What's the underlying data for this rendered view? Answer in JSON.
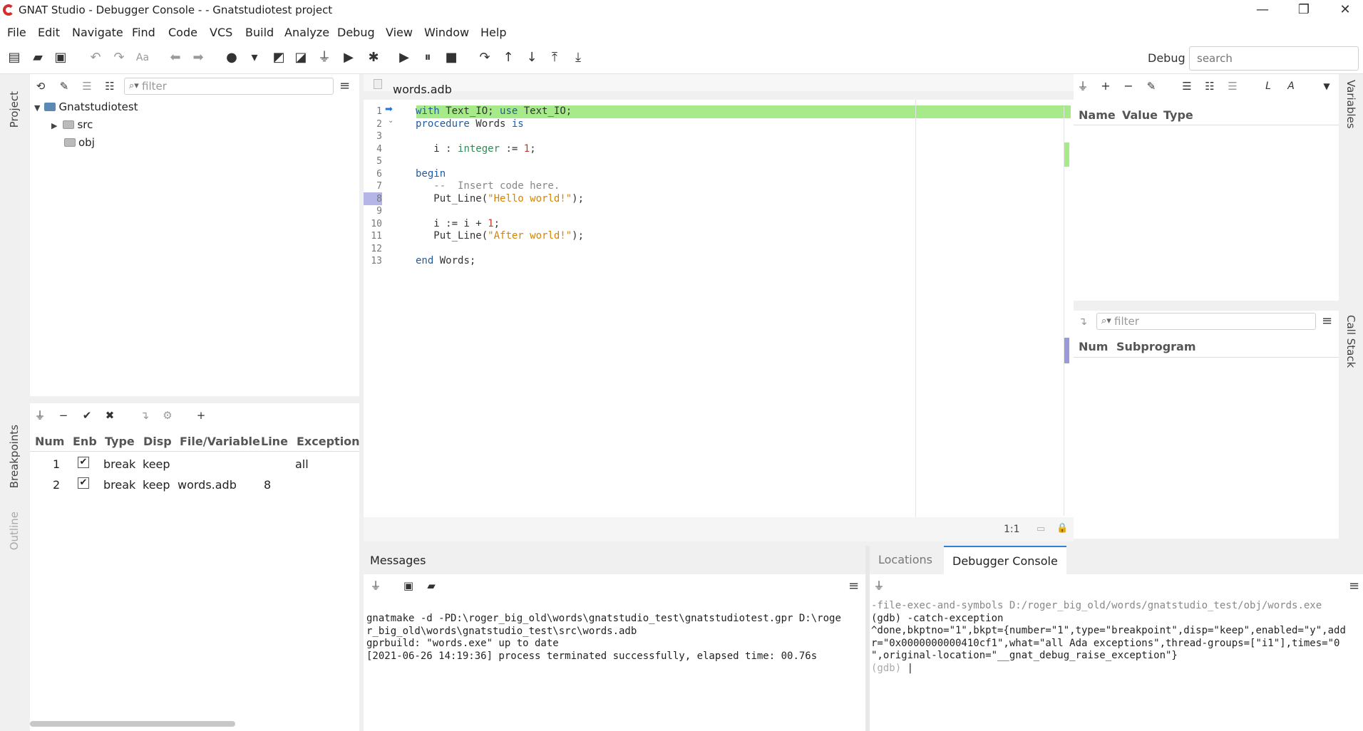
{
  "window": {
    "title": "GNAT Studio - Debugger Console -  - Gnatstudiotest project",
    "minimize": "—",
    "restore": "❐",
    "close": "✕"
  },
  "menu": [
    "File",
    "Edit",
    "Navigate",
    "Find",
    "Code",
    "VCS",
    "Build",
    "Analyze",
    "Debug",
    "View",
    "Window",
    "Help"
  ],
  "toolbar": {
    "perspective_label": "Debug",
    "search_placeholder": "search"
  },
  "project": {
    "tab_label": "Project",
    "filter_placeholder": "filter",
    "tree": [
      {
        "label": "Gnatstudiotest",
        "kind": "root"
      },
      {
        "label": "src",
        "kind": "folder"
      },
      {
        "label": "obj",
        "kind": "folder-obj"
      }
    ]
  },
  "breakpoints": {
    "tab_label": "Breakpoints",
    "outline_label": "Outline",
    "columns": [
      "Num",
      "Enb",
      "Type",
      "Disp",
      "File/Variable",
      "Line",
      "Exception"
    ],
    "rows": [
      {
        "num": "1",
        "type": "break",
        "disp": "keep",
        "file": "",
        "line": "",
        "exception": "all"
      },
      {
        "num": "2",
        "type": "break",
        "disp": "keep",
        "file": "words.adb",
        "line": "8",
        "exception": ""
      }
    ]
  },
  "editor": {
    "filename": "words.adb",
    "position": "1:1",
    "line_numbers": [
      "1",
      "2",
      "3",
      "4",
      "5",
      "6",
      "7",
      "8",
      "9",
      "10",
      "11",
      "12",
      "13"
    ]
  },
  "variables": {
    "tab_label": "Variables",
    "columns": [
      "Name",
      "Value",
      "Type"
    ]
  },
  "callstack": {
    "tab_label": "Call Stack",
    "filter_placeholder": "filter",
    "columns": [
      "Num",
      "Subprogram"
    ]
  },
  "messages": {
    "title": "Messages",
    "lines": [
      "gnatmake -d -PD:\\roger_big_old\\words\\gnatstudio_test\\gnatstudiotest.gpr D:\\roge",
      "r_big_old\\words\\gnatstudio_test\\src\\words.adb",
      "gprbuild: \"words.exe\" up to date",
      "[2021-06-26 14:19:36] process terminated successfully, elapsed time: 00.76s"
    ]
  },
  "console": {
    "tabs": [
      "Locations",
      "Debugger Console"
    ],
    "lines": [
      "-file-exec-and-symbols D:/roger_big_old/words/gnatstudio_test/obj/words.exe",
      "(gdb) -catch-exception",
      "^done,bkptno=\"1\",bkpt={number=\"1\",type=\"breakpoint\",disp=\"keep\",enabled=\"y\",add",
      "r=\"0x0000000000410cf1\",what=\"all Ada exceptions\",thread-groups=[\"i1\"],times=\"0",
      "\",original-location=\"__gnat_debug_raise_exception\"}",
      "(gdb) "
    ]
  },
  "colors": {
    "current_line": "#a6ea8a",
    "breakpoint_marker": "#9a9ad8"
  }
}
